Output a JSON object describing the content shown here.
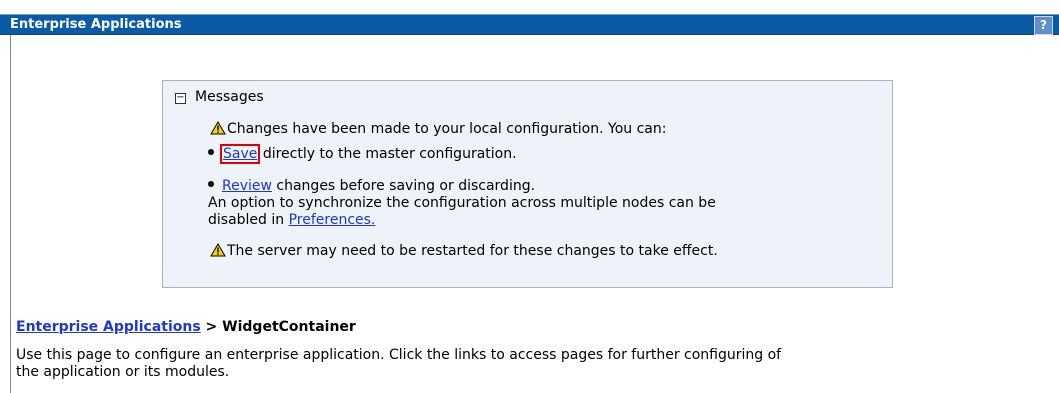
{
  "header": {
    "title": "Enterprise Applications",
    "help_label": "?"
  },
  "messages": {
    "title": "Messages",
    "collapse_symbol": "−",
    "warning1": "Changes have been made to your local configuration. You can:",
    "save_link": "Save",
    "save_rest": " directly to the master configuration.",
    "review_link": "Review",
    "review_rest": " changes before saving or discarding.",
    "sync_line1": "An option to synchronize the configuration across multiple nodes can be",
    "sync_line2_prefix": "disabled in ",
    "preferences_link": "Preferences.",
    "warning2": "The server may need to be restarted for these changes to take effect."
  },
  "breadcrumb": {
    "link": "Enterprise Applications",
    "separator": " > ",
    "current": "WidgetContainer"
  },
  "description": {
    "line1": "Use this page to configure an enterprise application. Click the links to access pages for further configuring of",
    "line2": "the application or its modules."
  },
  "colors": {
    "titlebar": "#0b5aa6",
    "link": "#1c37d6",
    "highlight": "#e10000",
    "warning": "#f2d300"
  }
}
